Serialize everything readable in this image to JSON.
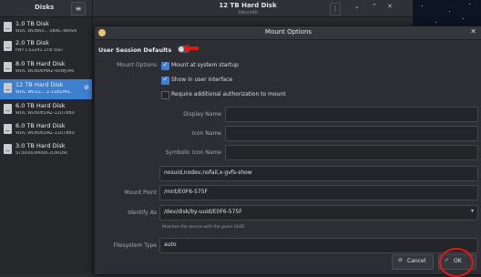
{
  "sidebar": {
    "title": "Disks",
    "menu_glyph": "≡",
    "items": [
      {
        "name": "1.0 TB Disk",
        "sub": "WDC WDBA3... 0BNC-WRSN"
      },
      {
        "name": "2.0 TB Disk",
        "sub": "PNY CS2241 2TB SSD"
      },
      {
        "name": "8.0 TB Hard Disk",
        "sub": "WDC WD80EMAZ-00WJTA0"
      },
      {
        "name": "12 TB Hard Disk",
        "sub": "WDC WD12... Z-11B1PA1",
        "selected": true
      },
      {
        "name": "6.0 TB Hard Disk",
        "sub": "WDC WD60EDAZ-11U78B0"
      },
      {
        "name": "6.0 TB Hard Disk",
        "sub": "WDC WD60EDAZ-11U78B0"
      },
      {
        "name": "3.0 TB Hard Disk",
        "sub": "ST3000DM008-2DM166"
      }
    ],
    "selected_badge": "⊘"
  },
  "main_header": {
    "title": "12 TB Hard Disk",
    "subtitle": "/dev/sdb",
    "more_glyph": "⋮",
    "min_glyph": "⌄",
    "max_glyph": "⌃",
    "close_glyph": "✕"
  },
  "dialog": {
    "title": "Mount Options",
    "close_glyph": "✕",
    "section_label": "User Session Defaults",
    "mount_options_label": "Mount Options",
    "checkboxes": [
      {
        "label": "Mount at system startup",
        "checked": true
      },
      {
        "label": "Show in user interface",
        "checked": true
      },
      {
        "label": "Require additional authorization to mount",
        "checked": false
      }
    ],
    "display_name_label": "Display Name",
    "display_name_value": "",
    "icon_name_label": "Icon Name",
    "icon_name_value": "",
    "symbolic_icon_label": "Symbolic Icon Name",
    "symbolic_icon_value": "",
    "options_value": "nosuid,nodev,nofail,x-gvfs-show",
    "mount_point_label": "Mount Point",
    "mount_point_value": "/mnt/E0F6-575F",
    "identify_as_label": "Identify As",
    "identify_as_value": "/dev/disk/by-uuid/E0F6-575F",
    "identify_as_hint": "Matches the device with the given UUID",
    "filesystem_type_label": "Filesystem Type",
    "filesystem_type_value": "auto",
    "cancel_label": "Cancel",
    "cancel_glyph": "⊘",
    "ok_label": "OK",
    "ok_glyph": "✓"
  },
  "colors": {
    "accent": "#3f7fcf",
    "annotation_red": "#e01818"
  }
}
